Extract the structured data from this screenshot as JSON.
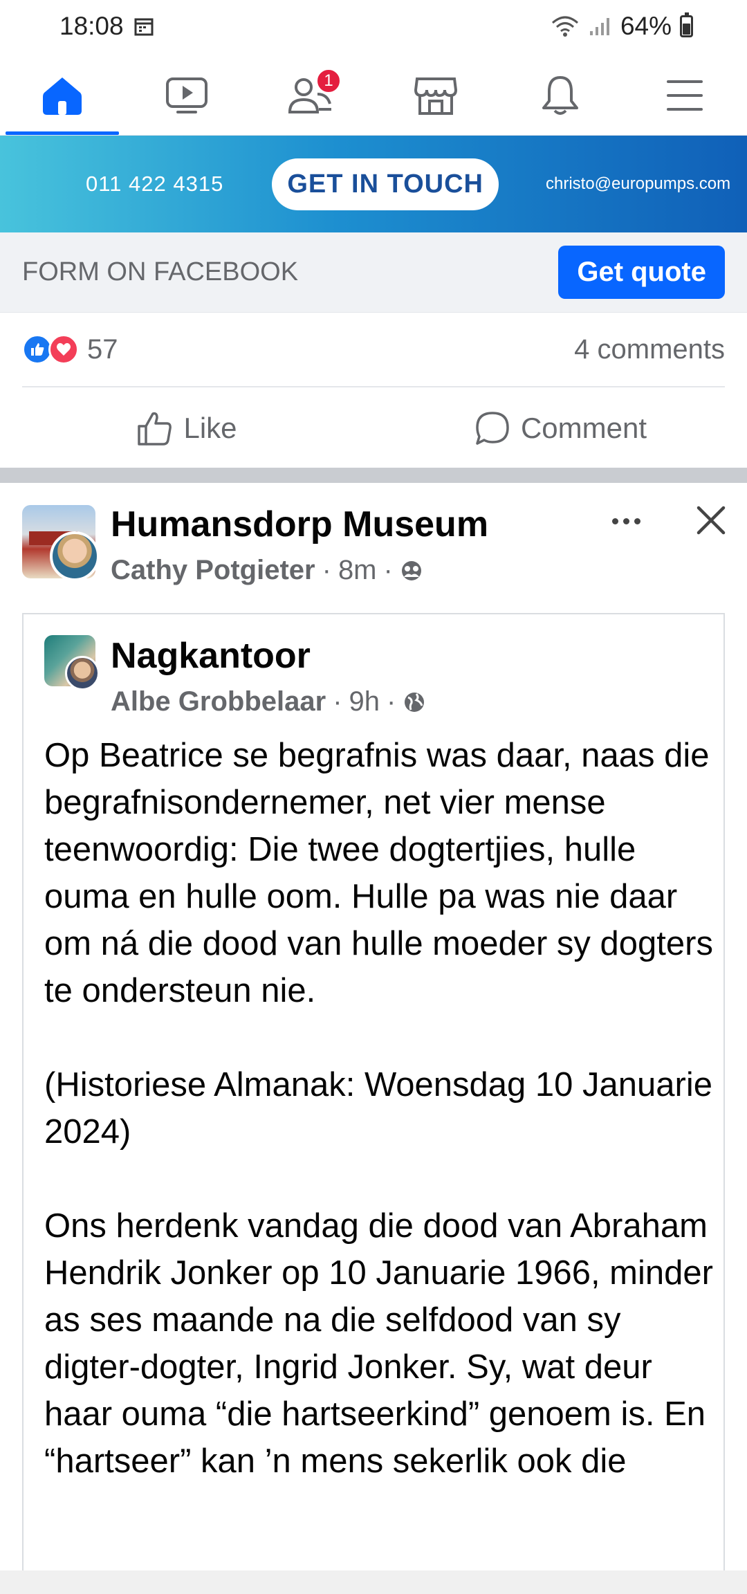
{
  "status_bar": {
    "time": "18:08",
    "battery": "64%"
  },
  "nav": {
    "friends_badge": "1"
  },
  "ad": {
    "phone": "011 422 4315",
    "cta": "GET IN TOUCH",
    "email": "christo@europumps.com"
  },
  "cta_row": {
    "label": "FORM ON FACEBOOK",
    "button": "Get quote"
  },
  "reactions": {
    "count": "57",
    "comments": "4 comments"
  },
  "actions": {
    "like": "Like",
    "comment": "Comment"
  },
  "post": {
    "group": "Humansdorp Museum",
    "author": "Cathy Potgieter",
    "time": "8m",
    "sep": "·"
  },
  "shared": {
    "page": "Nagkantoor",
    "author": "Albe Grobbelaar",
    "time": "9h",
    "paragraphs": [
      "Op  Beatrice se begrafnis was daar, naas die begrafnisondernemer, net vier mense teenwoordig: Die twee dogtertjies, hulle ouma en hulle oom. Hulle pa was nie daar om ná die dood van hulle moeder sy dogters te ondersteun nie.",
      "(Historiese Almanak: Woensdag 10 Januarie 2024)",
      "Ons herdenk vandag die dood van Abraham Hendrik Jonker op 10 Januarie 1966, minder as ses maande na die selfdood van sy digter-dogter, Ingrid Jonker. Sy, wat deur haar ouma “die hartseerkind” genoem is. En “hartseer” kan ’n mens sekerlik ook die"
    ]
  }
}
